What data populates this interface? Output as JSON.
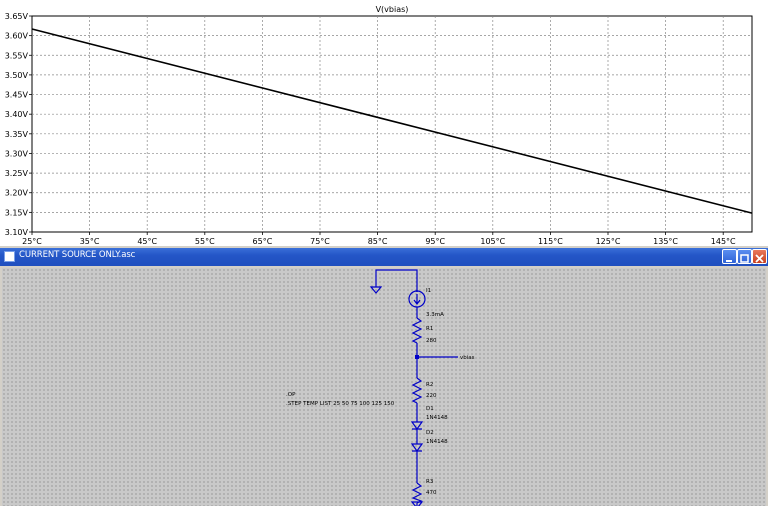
{
  "plot": {
    "title": "V(vbias)"
  },
  "chart_data": {
    "type": "line",
    "title": "V(vbias)",
    "xlabel": "",
    "ylabel": "",
    "x_ticks": [
      "25°C",
      "35°C",
      "45°C",
      "55°C",
      "65°C",
      "75°C",
      "85°C",
      "95°C",
      "105°C",
      "115°C",
      "125°C",
      "135°C",
      "145°C"
    ],
    "y_ticks": [
      "3.10V",
      "3.15V",
      "3.20V",
      "3.25V",
      "3.30V",
      "3.35V",
      "3.40V",
      "3.45V",
      "3.50V",
      "3.55V",
      "3.60V",
      "3.65V"
    ],
    "xlim": [
      25,
      150
    ],
    "ylim": [
      3.1,
      3.65
    ],
    "grid": true,
    "series": [
      {
        "name": "V(vbias)",
        "color": "#000000",
        "x": [
          25,
          150
        ],
        "y": [
          3.617,
          3.148
        ]
      }
    ]
  },
  "schematic": {
    "window_title": "CURRENT SOURCE ONLY.asc",
    "wire_color": "#0000c8",
    "current_source": {
      "name": "I1",
      "value": "3.3mA"
    },
    "r1": {
      "name": "R1",
      "value": "280"
    },
    "net_label": "vbias",
    "r2": {
      "name": "R2",
      "value": "220"
    },
    "d1": {
      "name": "D1",
      "value": "1N4148"
    },
    "d2": {
      "name": "D2",
      "value": "1N4148"
    },
    "r3": {
      "name": "R3",
      "value": "470"
    },
    "directive_line1": ".OP",
    "directive_line2": ".STEP TEMP LIST 25 50 75 100 125 150"
  }
}
